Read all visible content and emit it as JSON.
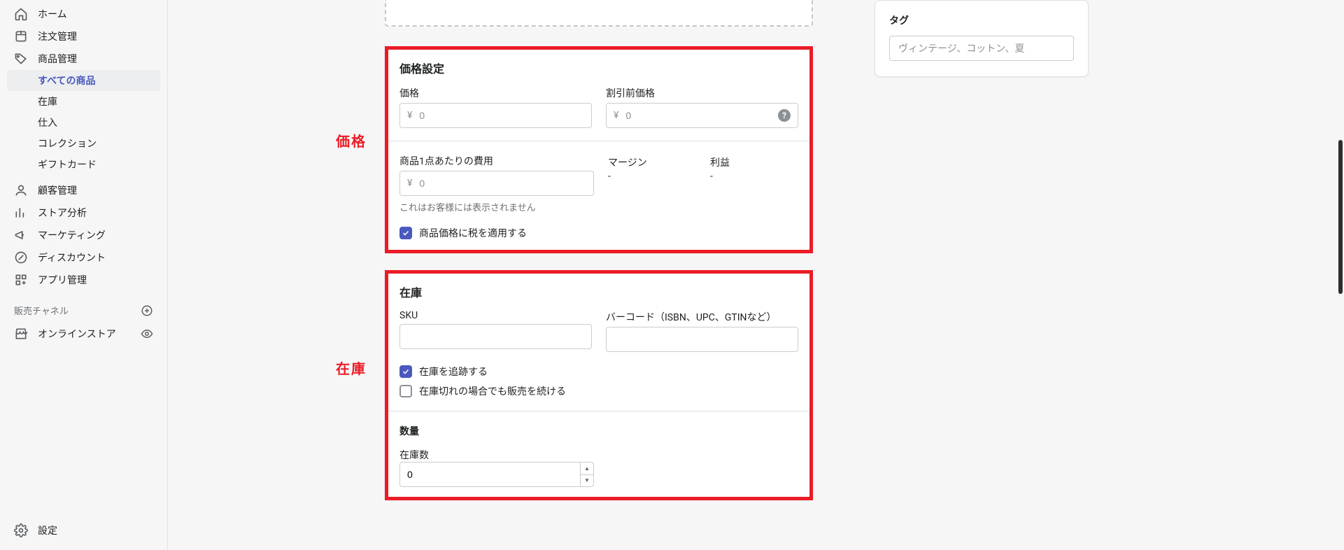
{
  "sidebar": {
    "main_items": [
      {
        "icon": "home",
        "label": "ホーム"
      },
      {
        "icon": "orders",
        "label": "注文管理"
      },
      {
        "icon": "products",
        "label": "商品管理",
        "expanded": true
      },
      {
        "icon": "customers",
        "label": "顧客管理"
      },
      {
        "icon": "analytics",
        "label": "ストア分析"
      },
      {
        "icon": "marketing",
        "label": "マーケティング"
      },
      {
        "icon": "discounts",
        "label": "ディスカウント"
      },
      {
        "icon": "apps",
        "label": "アプリ管理"
      }
    ],
    "product_subitems": [
      {
        "label": "すべての商品",
        "active": true
      },
      {
        "label": "在庫"
      },
      {
        "label": "仕入"
      },
      {
        "label": "コレクション"
      },
      {
        "label": "ギフトカード"
      }
    ],
    "channels_header": "販売チャネル",
    "channels": [
      {
        "icon": "store",
        "label": "オンラインストア",
        "right_icon": "eye"
      }
    ],
    "footer": {
      "icon": "gear",
      "label": "設定"
    }
  },
  "annotations": {
    "price": "価格",
    "inventory": "在庫"
  },
  "pricing": {
    "title": "価格設定",
    "price_label": "価格",
    "currency_symbol": "¥",
    "price_placeholder": "0",
    "compare_label": "割引前価格",
    "compare_placeholder": "0",
    "cost_label": "商品1点あたりの費用",
    "cost_placeholder": "0",
    "cost_hint": "これはお客様には表示されません",
    "margin_label": "マージン",
    "margin_value": "-",
    "profit_label": "利益",
    "profit_value": "-",
    "tax_checkbox_label": "商品価格に税を適用する",
    "tax_checked": true
  },
  "inventory": {
    "title": "在庫",
    "sku_label": "SKU",
    "sku_value": "",
    "barcode_label": "バーコード（ISBN、UPC、GTINなど）",
    "barcode_value": "",
    "track_label": "在庫を追跡する",
    "track_checked": true,
    "oversell_label": "在庫切れの場合でも販売を続ける",
    "oversell_checked": false,
    "quantity_title": "数量",
    "available_label": "在庫数",
    "available_value": "0"
  },
  "tags": {
    "title": "タグ",
    "placeholder": "ヴィンテージ、コットン、夏"
  }
}
